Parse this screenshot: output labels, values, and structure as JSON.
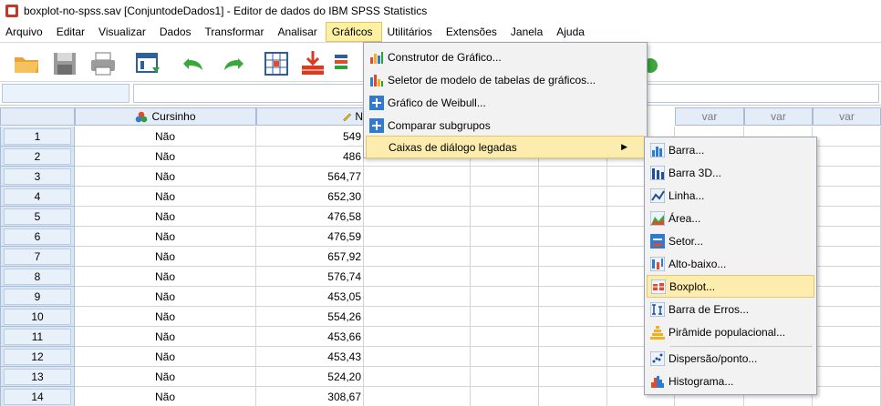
{
  "window": {
    "title": "boxplot-no-spss.sav [ConjuntodeDados1] - Editor de dados do IBM SPSS Statistics"
  },
  "menubar": [
    "Arquivo",
    "Editar",
    "Visualizar",
    "Dados",
    "Transformar",
    "Analisar",
    "Gráficos",
    "Utilitários",
    "Extensões",
    "Janela",
    "Ajuda"
  ],
  "toolbar": {
    "icons": [
      "open-folder-icon",
      "save-icon",
      "print-icon",
      "recall-dialog-icon",
      "undo-icon",
      "redo-icon",
      "goto-case-icon",
      "goto-variable-icon",
      "variables-icon"
    ]
  },
  "grid": {
    "columns": [
      "Cursinho",
      "N",
      "var",
      "var",
      "var"
    ],
    "rows": [
      {
        "n": "1",
        "cursinho": "Não",
        "nota": "549"
      },
      {
        "n": "2",
        "cursinho": "Não",
        "nota": "486"
      },
      {
        "n": "3",
        "cursinho": "Não",
        "nota": "564,77"
      },
      {
        "n": "4",
        "cursinho": "Não",
        "nota": "652,30"
      },
      {
        "n": "5",
        "cursinho": "Não",
        "nota": "476,58"
      },
      {
        "n": "6",
        "cursinho": "Não",
        "nota": "476,59"
      },
      {
        "n": "7",
        "cursinho": "Não",
        "nota": "657,92"
      },
      {
        "n": "8",
        "cursinho": "Não",
        "nota": "576,74"
      },
      {
        "n": "9",
        "cursinho": "Não",
        "nota": "453,05"
      },
      {
        "n": "10",
        "cursinho": "Não",
        "nota": "554,26"
      },
      {
        "n": "11",
        "cursinho": "Não",
        "nota": "453,66"
      },
      {
        "n": "12",
        "cursinho": "Não",
        "nota": "453,43"
      },
      {
        "n": "13",
        "cursinho": "Não",
        "nota": "524,20"
      },
      {
        "n": "14",
        "cursinho": "Não",
        "nota": "308,67"
      }
    ]
  },
  "graficos_menu": {
    "items": [
      {
        "label": "Construtor de Gráfico...",
        "icon": "chart-builder-icon"
      },
      {
        "label": "Seletor de modelo de tabelas de gráficos...",
        "icon": "template-chooser-icon"
      },
      {
        "label": "Gráfico de Weibull...",
        "icon": "weibull-icon"
      },
      {
        "label": "Comparar subgrupos",
        "icon": "compare-subgroups-icon"
      },
      {
        "label": "Caixas de diálogo legadas",
        "icon": ""
      }
    ]
  },
  "legacy_submenu": {
    "items": [
      {
        "label": "Barra...",
        "icon": "bar-icon"
      },
      {
        "label": "Barra 3D...",
        "icon": "bar-3d-icon"
      },
      {
        "label": "Linha...",
        "icon": "line-icon"
      },
      {
        "label": "Área...",
        "icon": "area-icon"
      },
      {
        "label": "Setor...",
        "icon": "pie-icon"
      },
      {
        "label": "Alto-baixo...",
        "icon": "high-low-icon"
      },
      {
        "label": "Boxplot...",
        "icon": "boxplot-icon"
      },
      {
        "label": "Barra de Erros...",
        "icon": "error-bar-icon"
      },
      {
        "label": "Pirâmide populacional...",
        "icon": "population-pyramid-icon"
      },
      {
        "label": "Dispersão/ponto...",
        "icon": "scatter-icon"
      },
      {
        "label": "Histograma...",
        "icon": "histogram-icon"
      }
    ]
  }
}
